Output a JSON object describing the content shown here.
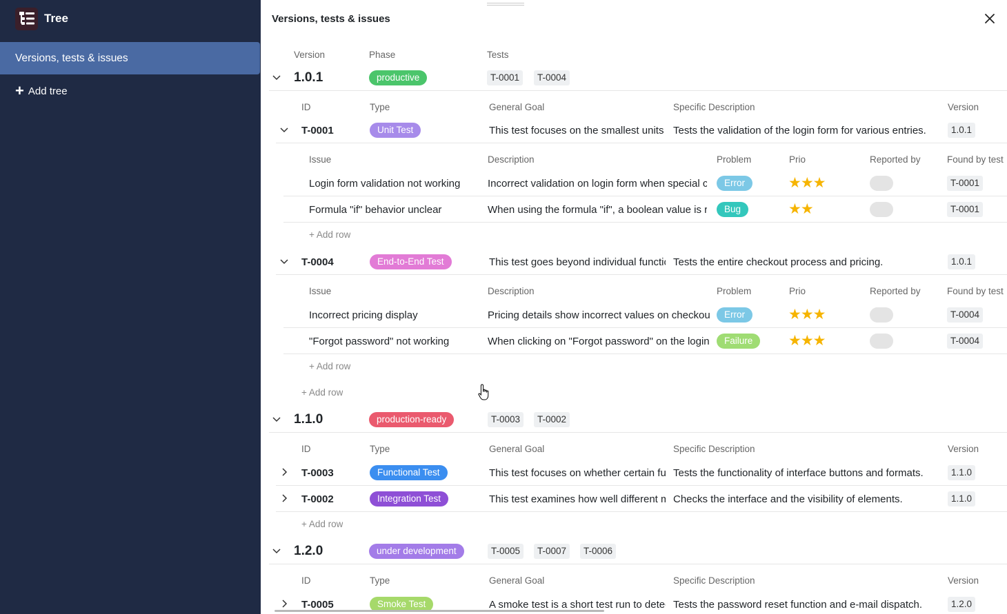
{
  "app": {
    "title": "Tree"
  },
  "sidebar": {
    "items": [
      {
        "label": "Versions, tests & issues"
      }
    ],
    "add_tree_label": "Add tree"
  },
  "panel": {
    "title": "Versions, tests & issues"
  },
  "version_headers": {
    "version": "Version",
    "phase": "Phase",
    "tests": "Tests"
  },
  "test_headers": {
    "id": "ID",
    "type": "Type",
    "general_goal": "General Goal",
    "specific_description": "Specific Description",
    "version": "Version"
  },
  "issue_headers": {
    "issue": "Issue",
    "description": "Description",
    "problem": "Problem",
    "prio": "Prio",
    "reported_by": "Reported by",
    "found_by_test": "Found by test"
  },
  "add_row_label": "+ Add row",
  "colors": {
    "productive": "#4bc56b",
    "production_ready": "#ea5a6e",
    "under_development": "#a37ce8",
    "unit_test": "#a78bea",
    "end_to_end_test": "#e27bd6",
    "functional_test": "#3b8ef0",
    "integration_test": "#8e4fd6",
    "smoke_test": "#a6d96a",
    "error": "#7cc8e6",
    "bug": "#33c7bc",
    "failure": "#9fdc73",
    "star": "#f6b400"
  },
  "versions": [
    {
      "version": "1.0.1",
      "phase": "productive",
      "tests": [
        "T-0001",
        "T-0004"
      ],
      "test_rows": [
        {
          "id": "T-0001",
          "type": "Unit Test",
          "general_goal": "This test focuses on the smallest units of code",
          "specific_description": "Tests the validation of the login form for various entries.",
          "version": "1.0.1",
          "issues": [
            {
              "issue": "Login form validation not working",
              "description": "Incorrect validation on login form when special characters are entered",
              "problem": "Error",
              "prio": 3,
              "found_by_test": "T-0001"
            },
            {
              "issue": "Formula \"if\" behavior unclear",
              "description": "When using the formula \"if\", a boolean value is returned",
              "problem": "Bug",
              "prio": 2,
              "found_by_test": "T-0001"
            }
          ]
        },
        {
          "id": "T-0004",
          "type": "End-to-End Test",
          "general_goal": "This test goes beyond individual functions",
          "specific_description": "Tests the entire checkout process and pricing.",
          "version": "1.0.1",
          "issues": [
            {
              "issue": "Incorrect pricing display",
              "description": "Pricing details show incorrect values on checkout page",
              "problem": "Error",
              "prio": 3,
              "found_by_test": "T-0004"
            },
            {
              "issue": "\"Forgot password\" not working",
              "description": "When clicking on \"Forgot password\" on the login page",
              "problem": "Failure",
              "prio": 3,
              "found_by_test": "T-0004"
            }
          ]
        }
      ]
    },
    {
      "version": "1.1.0",
      "phase": "production-ready",
      "tests": [
        "T-0003",
        "T-0002"
      ],
      "test_rows": [
        {
          "id": "T-0003",
          "type": "Functional Test",
          "general_goal": "This test focuses on whether certain functions work",
          "specific_description": "Tests the functionality of interface buttons and formats.",
          "version": "1.1.0"
        },
        {
          "id": "T-0002",
          "type": "Integration Test",
          "general_goal": "This test examines how well different modules work together",
          "specific_description": "Checks the interface and the visibility of elements.",
          "version": "1.1.0"
        }
      ]
    },
    {
      "version": "1.2.0",
      "phase": "under development",
      "tests": [
        "T-0005",
        "T-0007",
        "T-0006"
      ],
      "test_rows": [
        {
          "id": "T-0005",
          "type": "Smoke Test",
          "general_goal": "A smoke test is a short test run to detect major failures",
          "specific_description": "Tests the password reset function and e-mail dispatch.",
          "version": "1.2.0"
        }
      ]
    }
  ]
}
